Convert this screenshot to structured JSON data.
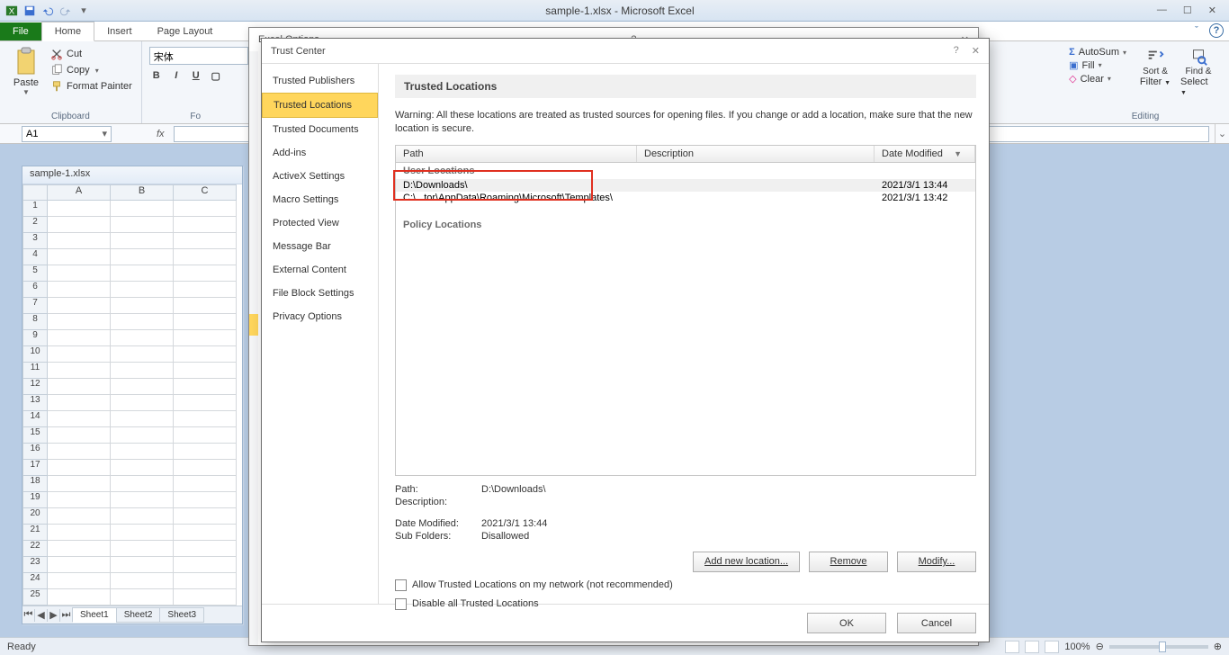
{
  "app": {
    "title": "sample-1.xlsx - Microsoft Excel"
  },
  "qat": {
    "save": "save",
    "undo": "undo",
    "redo": "redo"
  },
  "tabs": {
    "file": "File",
    "home": "Home",
    "insert": "Insert",
    "page_layout": "Page Layout"
  },
  "ribbon": {
    "clipboard": {
      "paste": "Paste",
      "cut": "Cut",
      "copy": "Copy",
      "format_painter": "Format Painter",
      "group": "Clipboard"
    },
    "font": {
      "name": "宋体",
      "bold": "B",
      "italic": "I",
      "underline": "U",
      "group": "Fo"
    },
    "editing": {
      "autosum": "AutoSum",
      "fill": "Fill",
      "clear": "Clear",
      "sort": "Sort &",
      "sort2": "Filter",
      "find": "Find &",
      "find2": "Select",
      "group": "Editing"
    }
  },
  "namebox": {
    "value": "A1"
  },
  "workbook": {
    "title": "sample-1.xlsx",
    "cols": [
      "A",
      "B",
      "C"
    ],
    "sheets": [
      "Sheet1",
      "Sheet2",
      "Sheet3"
    ]
  },
  "status": {
    "ready": "Ready",
    "zoom": "100%"
  },
  "options_modal": {
    "title": "Excel Options"
  },
  "tc": {
    "title": "Trust Center",
    "sidebar": [
      "Trusted Publishers",
      "Trusted Locations",
      "Trusted Documents",
      "Add-ins",
      "ActiveX Settings",
      "Macro Settings",
      "Protected View",
      "Message Bar",
      "External Content",
      "File Block Settings",
      "Privacy Options"
    ],
    "heading": "Trusted Locations",
    "warning": "Warning: All these locations are treated as trusted sources for opening files.  If you change or add a location, make sure that the new location is secure.",
    "cols": {
      "path": "Path",
      "desc": "Description",
      "date": "Date Modified"
    },
    "user_loc_label": "User Locations",
    "rows": [
      {
        "path": "D:\\Downloads\\",
        "desc": "",
        "date": "2021/3/1 13:44"
      },
      {
        "path": "C:\\...tor\\AppData\\Roaming\\Microsoft\\Templates\\",
        "desc": "",
        "date": "2021/3/1 13:42"
      }
    ],
    "policy_loc_label": "Policy Locations",
    "details": {
      "path_l": "Path:",
      "path_v": "D:\\Downloads\\",
      "desc_l": "Description:",
      "desc_v": "",
      "date_l": "Date Modified:",
      "date_v": "2021/3/1 13:44",
      "sub_l": "Sub Folders:",
      "sub_v": "Disallowed"
    },
    "buttons": {
      "add": "Add new location...",
      "remove": "Remove",
      "modify": "Modify..."
    },
    "chk_net": "Allow Trusted Locations on my network (not recommended)",
    "chk_dis": "Disable all Trusted Locations",
    "ok": "OK",
    "cancel": "Cancel"
  }
}
